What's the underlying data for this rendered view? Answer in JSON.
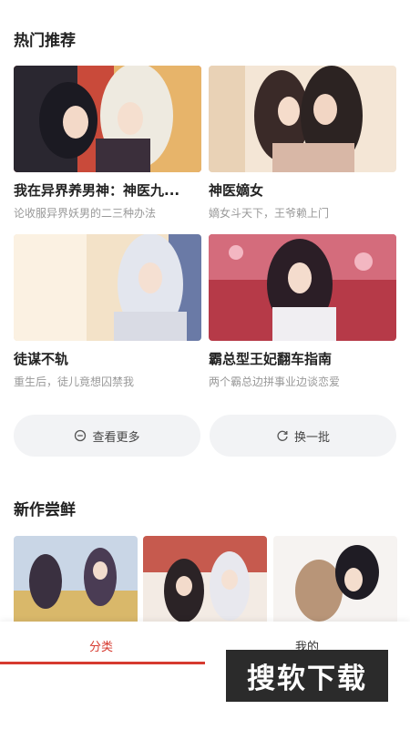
{
  "hot": {
    "title": "热门推荐",
    "items": [
      {
        "title": "我在异界养男神：神医九...",
        "desc": "论收服异界妖男的二三种办法"
      },
      {
        "title": "神医嫡女",
        "desc": "嫡女斗天下，王爷赖上门"
      },
      {
        "title": "徒谋不轨",
        "desc": "重生后，徒儿竟想囚禁我"
      },
      {
        "title": "霸总型王妃翻车指南",
        "desc": "两个霸总边拼事业边谈恋爱"
      }
    ],
    "more_label": "查看更多",
    "refresh_label": "换一批"
  },
  "new": {
    "title": "新作尝鲜"
  },
  "tabs": {
    "category": "分类",
    "mine": "我的"
  },
  "watermark": "搜软下载",
  "colors": {
    "accent": "#d63a2f",
    "pill_bg": "#f2f3f5",
    "muted_text": "#999999"
  }
}
